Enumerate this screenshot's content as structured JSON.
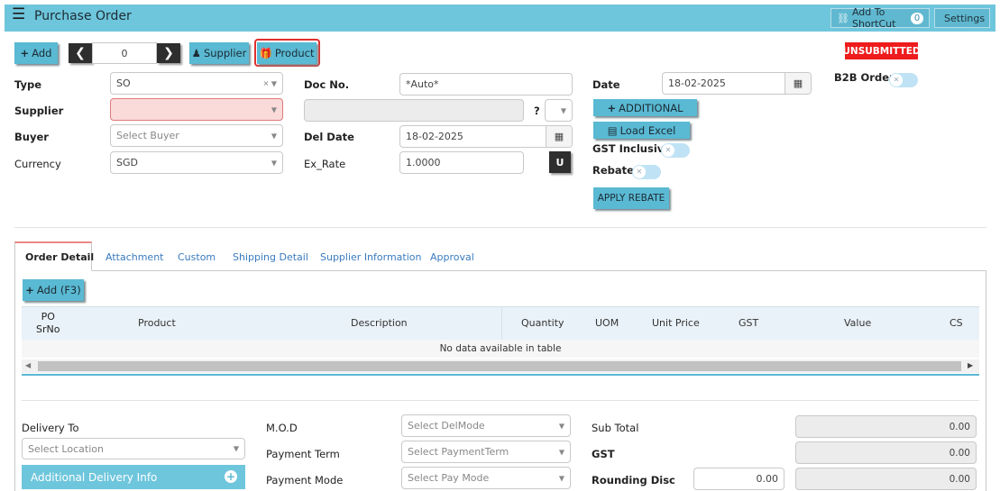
{
  "header": {
    "title": "Purchase Order",
    "shortcut_label": "Add To ShortCut",
    "shortcut_count": "0",
    "settings_label": "Settings"
  },
  "toolbar": {
    "add_label": "Add",
    "record_index": "0",
    "supplier_label": "Supplier",
    "product_label": "Product"
  },
  "status": {
    "label": "UNSUBMITTED",
    "color": "#ee1c1c"
  },
  "b2b": {
    "label": "B2B Order",
    "on": false
  },
  "form": {
    "type_label": "Type",
    "type_value": "SO",
    "supplier_label": "Supplier",
    "supplier_value": "",
    "buyer_label": "Buyer",
    "buyer_placeholder": "Select Buyer",
    "currency_label": "Currency",
    "currency_value": "SGD",
    "docno_label": "Doc No.",
    "docno_value": "*Auto*",
    "supplier_name_value": "",
    "question_mark": "?",
    "deldate_label": "Del Date",
    "deldate_value": "18-02-2025",
    "exrate_label": "Ex_Rate",
    "exrate_value": "1.0000",
    "u_button": "U",
    "date_label": "Date",
    "date_value": "18-02-2025",
    "additional_label": "ADDITIONAL",
    "load_excel_label": "Load Excel",
    "gst_inclusive_label": "GST Inclusive",
    "rebate_label": "Rebate",
    "apply_rebate_label": "APPLY REBATE"
  },
  "tabs": [
    {
      "label": "Order Detail",
      "active": true
    },
    {
      "label": "Attachment"
    },
    {
      "label": "Custom"
    },
    {
      "label": "Shipping Detail"
    },
    {
      "label": "Supplier Information"
    },
    {
      "label": "Approval"
    }
  ],
  "grid": {
    "add_label": "Add (F3)",
    "columns": [
      "PO SrNo",
      "Product",
      "Description",
      "Quantity",
      "UOM",
      "Unit Price",
      "GST",
      "Value",
      "CS"
    ],
    "col_po_1": "PO",
    "col_po_2": "SrNo",
    "empty_text": "No data available in table"
  },
  "footer": {
    "delivery_to_label": "Delivery To",
    "location_placeholder": "Select Location",
    "additional_delivery_label": "Additional Delivery Info",
    "mod_label": "M.O.D",
    "mod_placeholder": "Select DelMode",
    "payment_term_label": "Payment Term",
    "payment_term_placeholder": "Select PaymentTerm",
    "payment_mode_label": "Payment Mode",
    "payment_mode_placeholder": "Select Pay Mode",
    "subtotal_label": "Sub Total",
    "subtotal_value": "0.00",
    "gst_label": "GST",
    "gst_value": "0.00",
    "rounding_label": "Rounding Disc",
    "rounding_input": "0.00",
    "rounding_value": "0.00"
  },
  "colors": {
    "accent": "#5ab9d3",
    "header_bar": "#6ec6dc",
    "highlight_border": "#e03030"
  }
}
